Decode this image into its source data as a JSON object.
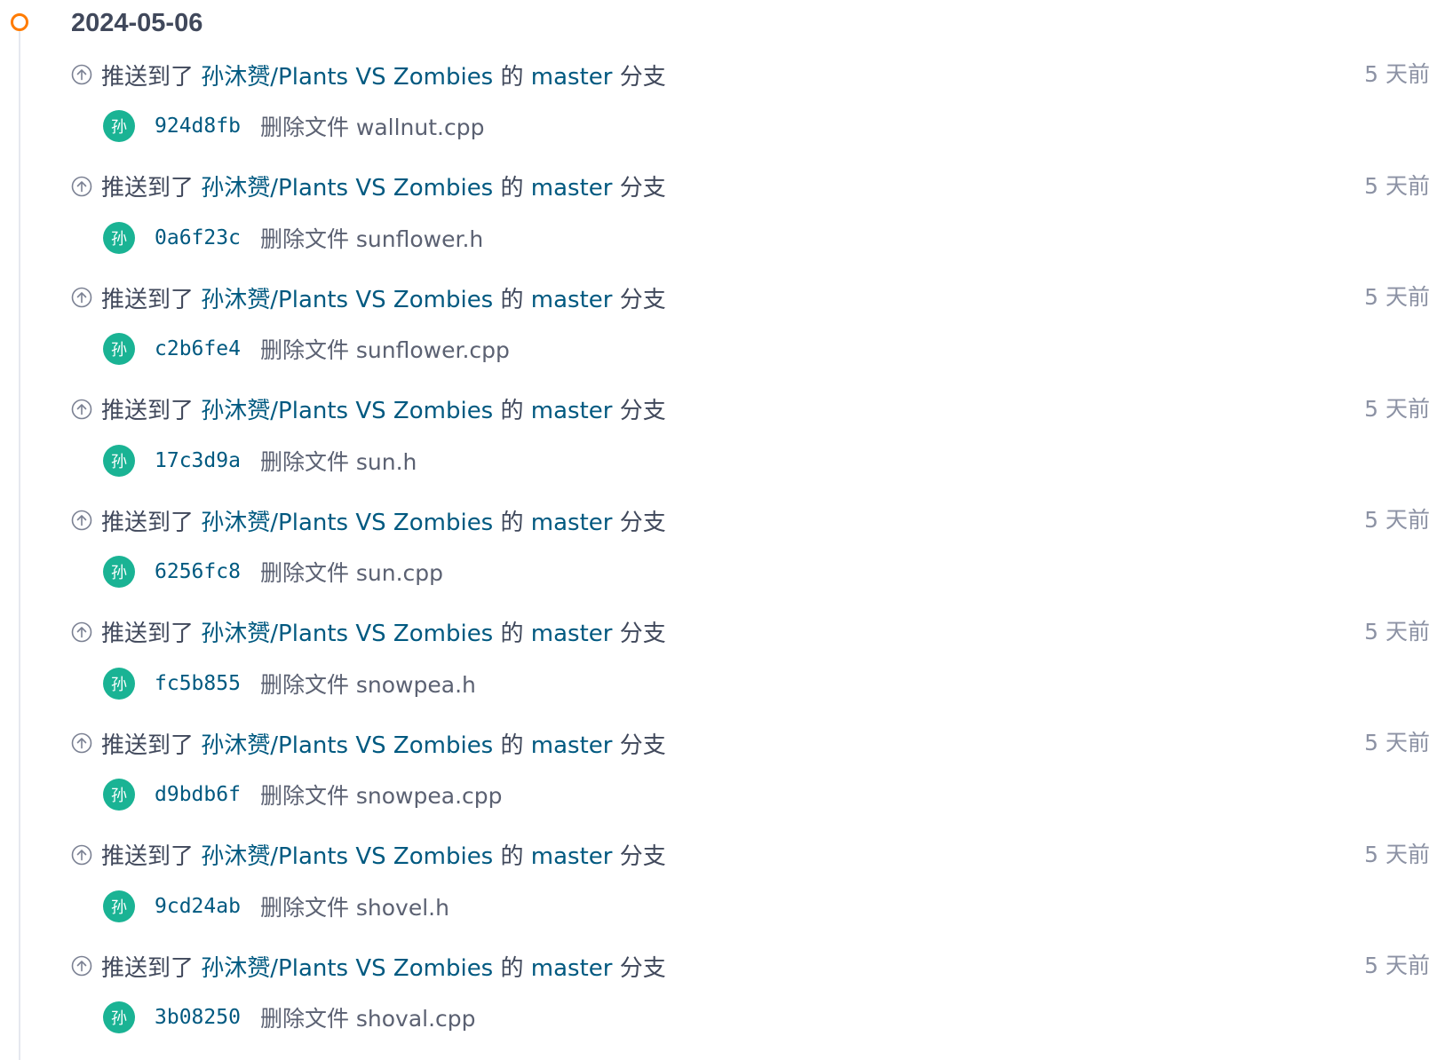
{
  "timeline": {
    "date": "2024-05-06",
    "accent_color": "#ff7b00"
  },
  "colors": {
    "link": "#005980",
    "avatar_bg": "#1ab394",
    "muted": "#8c92a4"
  },
  "events": [
    {
      "action": "推送到了",
      "repo": "孙沐赟/Plants VS Zombies",
      "mid": "的",
      "branch": "master",
      "tail": "分支",
      "time": "5 天前",
      "avatar": "孙",
      "sha": "924d8fb",
      "message": "删除文件 wallnut.cpp"
    },
    {
      "action": "推送到了",
      "repo": "孙沐赟/Plants VS Zombies",
      "mid": "的",
      "branch": "master",
      "tail": "分支",
      "time": "5 天前",
      "avatar": "孙",
      "sha": "0a6f23c",
      "message": "删除文件 sunflower.h"
    },
    {
      "action": "推送到了",
      "repo": "孙沐赟/Plants VS Zombies",
      "mid": "的",
      "branch": "master",
      "tail": "分支",
      "time": "5 天前",
      "avatar": "孙",
      "sha": "c2b6fe4",
      "message": "删除文件 sunflower.cpp"
    },
    {
      "action": "推送到了",
      "repo": "孙沐赟/Plants VS Zombies",
      "mid": "的",
      "branch": "master",
      "tail": "分支",
      "time": "5 天前",
      "avatar": "孙",
      "sha": "17c3d9a",
      "message": "删除文件 sun.h"
    },
    {
      "action": "推送到了",
      "repo": "孙沐赟/Plants VS Zombies",
      "mid": "的",
      "branch": "master",
      "tail": "分支",
      "time": "5 天前",
      "avatar": "孙",
      "sha": "6256fc8",
      "message": "删除文件 sun.cpp"
    },
    {
      "action": "推送到了",
      "repo": "孙沐赟/Plants VS Zombies",
      "mid": "的",
      "branch": "master",
      "tail": "分支",
      "time": "5 天前",
      "avatar": "孙",
      "sha": "fc5b855",
      "message": "删除文件 snowpea.h"
    },
    {
      "action": "推送到了",
      "repo": "孙沐赟/Plants VS Zombies",
      "mid": "的",
      "branch": "master",
      "tail": "分支",
      "time": "5 天前",
      "avatar": "孙",
      "sha": "d9bdb6f",
      "message": "删除文件 snowpea.cpp"
    },
    {
      "action": "推送到了",
      "repo": "孙沐赟/Plants VS Zombies",
      "mid": "的",
      "branch": "master",
      "tail": "分支",
      "time": "5 天前",
      "avatar": "孙",
      "sha": "9cd24ab",
      "message": "删除文件 shovel.h"
    },
    {
      "action": "推送到了",
      "repo": "孙沐赟/Plants VS Zombies",
      "mid": "的",
      "branch": "master",
      "tail": "分支",
      "time": "5 天前",
      "avatar": "孙",
      "sha": "3b08250",
      "message": "删除文件 shoval.cpp"
    }
  ]
}
